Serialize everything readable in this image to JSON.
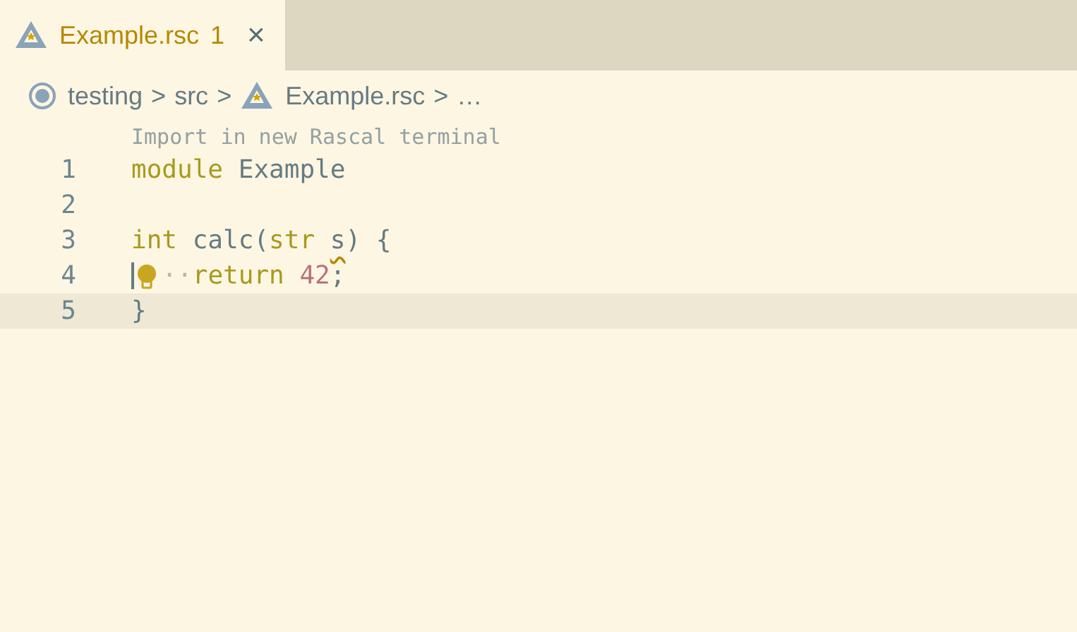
{
  "tab": {
    "label": "Example.rsc",
    "problems": "1",
    "close": "×",
    "selected": true
  },
  "breadcrumbs": [
    {
      "label": "testing",
      "kind": "root",
      "separator": ">"
    },
    {
      "label": "src",
      "kind": "folder",
      "separator": ">"
    },
    {
      "label": "Example.rsc",
      "kind": "file",
      "separator": ">"
    },
    {
      "label": "…",
      "kind": "more"
    }
  ],
  "codelens": "Import in new Rascal terminal",
  "lines": [
    {
      "number": "1",
      "current": false,
      "tokens": [
        {
          "text": "module",
          "kind": "keyword"
        },
        {
          "text": "Example",
          "kind": "plain"
        }
      ]
    },
    {
      "number": "2",
      "current": false
    },
    {
      "number": "3",
      "current": false,
      "tokens": [
        {
          "text": "int",
          "kind": "keyword"
        },
        {
          "text": "calc(",
          "kind": "mixed"
        },
        {
          "text": "str",
          "kind": "keyword"
        },
        {
          "text": "s",
          "kind": "plain",
          "warning": true
        },
        {
          "text": ")",
          "kind": "punct"
        },
        {
          "text": "{",
          "kind": "plain"
        }
      ]
    },
    {
      "number": "4",
      "current": false,
      "cursor": true,
      "lightbulb": true,
      "tokens": [
        {
          "text": "··",
          "kind": "whitespace"
        },
        {
          "text": "return",
          "kind": "keyword"
        },
        {
          "text": "42",
          "kind": "number"
        },
        {
          "text": ";",
          "kind": "punct"
        }
      ]
    },
    {
      "number": "5",
      "current": true,
      "tokens": [
        {
          "text": "}",
          "kind": "plain"
        }
      ]
    }
  ]
}
